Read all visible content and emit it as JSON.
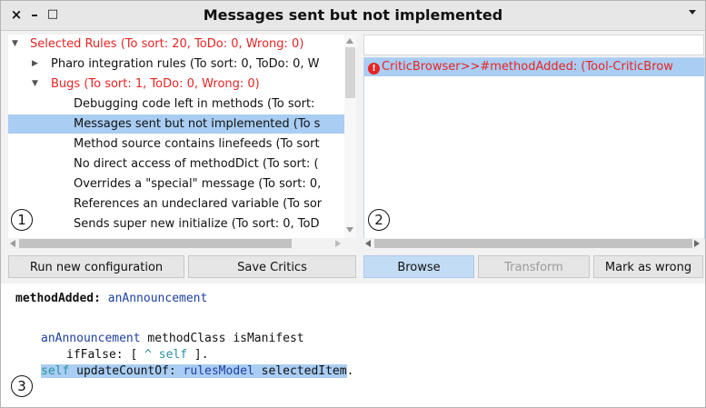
{
  "window": {
    "title": "Messages sent but not implemented",
    "close": "×",
    "minimize": "–",
    "maximize": "□"
  },
  "tree": {
    "rows": [
      {
        "label": "Selected Rules (To sort: 20, ToDo: 0, Wrong: 0)",
        "color": "red",
        "arrow": "▼"
      },
      {
        "label": "Pharo integration rules (To sort: 0, ToDo: 0, W",
        "color": "dark",
        "arrow": "▶"
      },
      {
        "label": "Bugs (To sort: 1, ToDo: 0, Wrong: 0)",
        "color": "red",
        "arrow": "▼"
      },
      {
        "label": "Debugging code left in methods (To sort:",
        "color": "dark",
        "arrow": ""
      },
      {
        "label": "Messages sent but not implemented (To s",
        "color": "dark",
        "arrow": "",
        "selected": true
      },
      {
        "label": "Method source contains linefeeds (To sort",
        "color": "dark",
        "arrow": ""
      },
      {
        "label": "No direct access of methodDict (To sort: (",
        "color": "dark",
        "arrow": ""
      },
      {
        "label": "Overrides a \"special\" message (To sort: 0,",
        "color": "dark",
        "arrow": ""
      },
      {
        "label": "References an undeclared variable (To sor",
        "color": "dark",
        "arrow": ""
      },
      {
        "label": "Sends super new initialize (To sort: 0, ToD",
        "color": "dark",
        "arrow": ""
      }
    ]
  },
  "critics": {
    "filter_value": "",
    "items": [
      "CriticBrowser>>#methodAdded: (Tool-CriticBrow"
    ],
    "warning_glyph": "!"
  },
  "buttons": {
    "run": "Run new configuration",
    "save": "Save Critics",
    "browse": "Browse",
    "transform": "Transform",
    "mark_wrong": "Mark as wrong"
  },
  "code": {
    "line1_selector": "methodAdded:",
    "line1_arg": " anAnnouncement",
    "line2_arg": "anAnnouncement",
    "line2_rest": " methodClass isManifest",
    "line3_a": "ifFalse: [ ",
    "line3_b": "^ self",
    "line3_c": " ].",
    "line4_self": "self",
    "line4_mid": " updateCountOf: ",
    "line4_model": "rulesModel",
    "line4_end": " selectedItem",
    "line4_dot": "."
  },
  "badges": [
    "1",
    "2",
    "3"
  ],
  "colors": {
    "selection": "#a9cdf3",
    "error_red": "#e82424",
    "button_blue": "#c3dcf5"
  }
}
